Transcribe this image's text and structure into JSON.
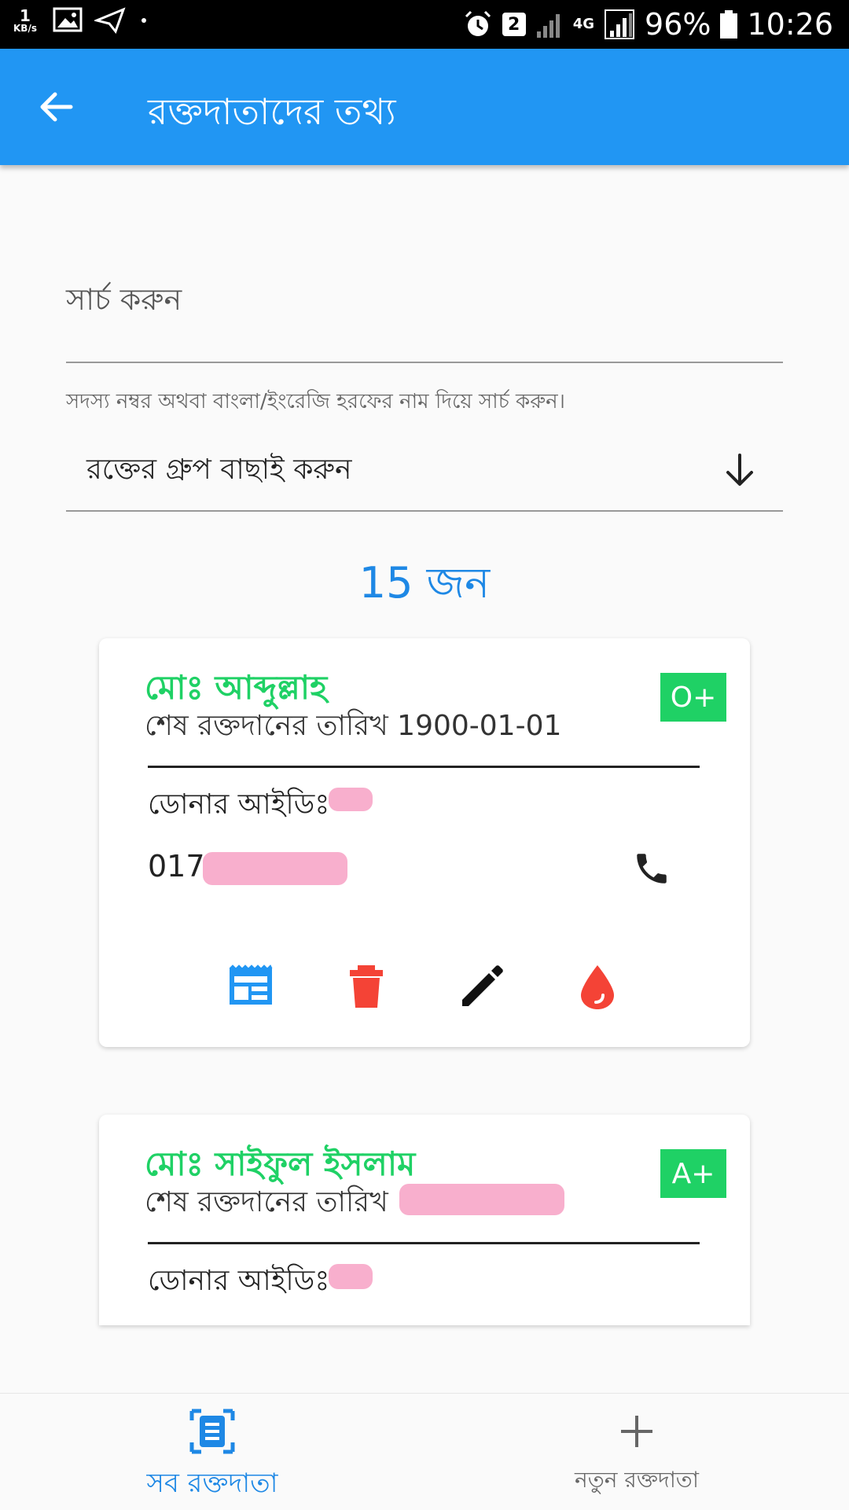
{
  "status_bar": {
    "speed_value": "1",
    "speed_unit": "KB/s",
    "sim_number": "2",
    "network": "4G",
    "battery": "96%",
    "time": "10:26"
  },
  "app_bar": {
    "title": "রক্তদাতাদের তথ্য"
  },
  "search": {
    "label": "সার্চ করুন",
    "value": "",
    "helper": "সদস্য নম্বর অথবা বাংলা/ইংরেজি হরফের নাম দিয়ে সার্চ করুন।"
  },
  "group_select": {
    "label": "রক্তের গ্রুপ বাছাই করুন"
  },
  "count": "15 জন",
  "colors": {
    "primary": "#2196f3",
    "accent_green": "#1fd165",
    "delete_red": "#f44336",
    "blood_red": "#f44336",
    "redacted": "#f8afcd"
  },
  "donors": [
    {
      "name": "মোঃ আব্দুল্লাহ",
      "last_donation_label": "শেষ রক্তদানের তারিখ",
      "last_donation_date": "1900-01-01",
      "blood_group": "O+",
      "donor_id_label": "ডোনার আইডিঃ",
      "phone_prefix": "017",
      "actions": [
        "details-icon",
        "delete-icon",
        "edit-icon",
        "blood-drop-icon"
      ]
    },
    {
      "name": "মোঃ সাইফুল ইসলাম",
      "last_donation_label": "শেষ রক্তদানের তারিখ",
      "blood_group": "A+",
      "donor_id_label": "ডোনার আইডিঃ"
    }
  ],
  "bottom_nav": {
    "items": [
      {
        "label": "সব রক্তদাতা",
        "icon": "list-icon",
        "active": true
      },
      {
        "label": "নতুন রক্তদাতা",
        "icon": "add-icon",
        "active": false
      }
    ]
  }
}
